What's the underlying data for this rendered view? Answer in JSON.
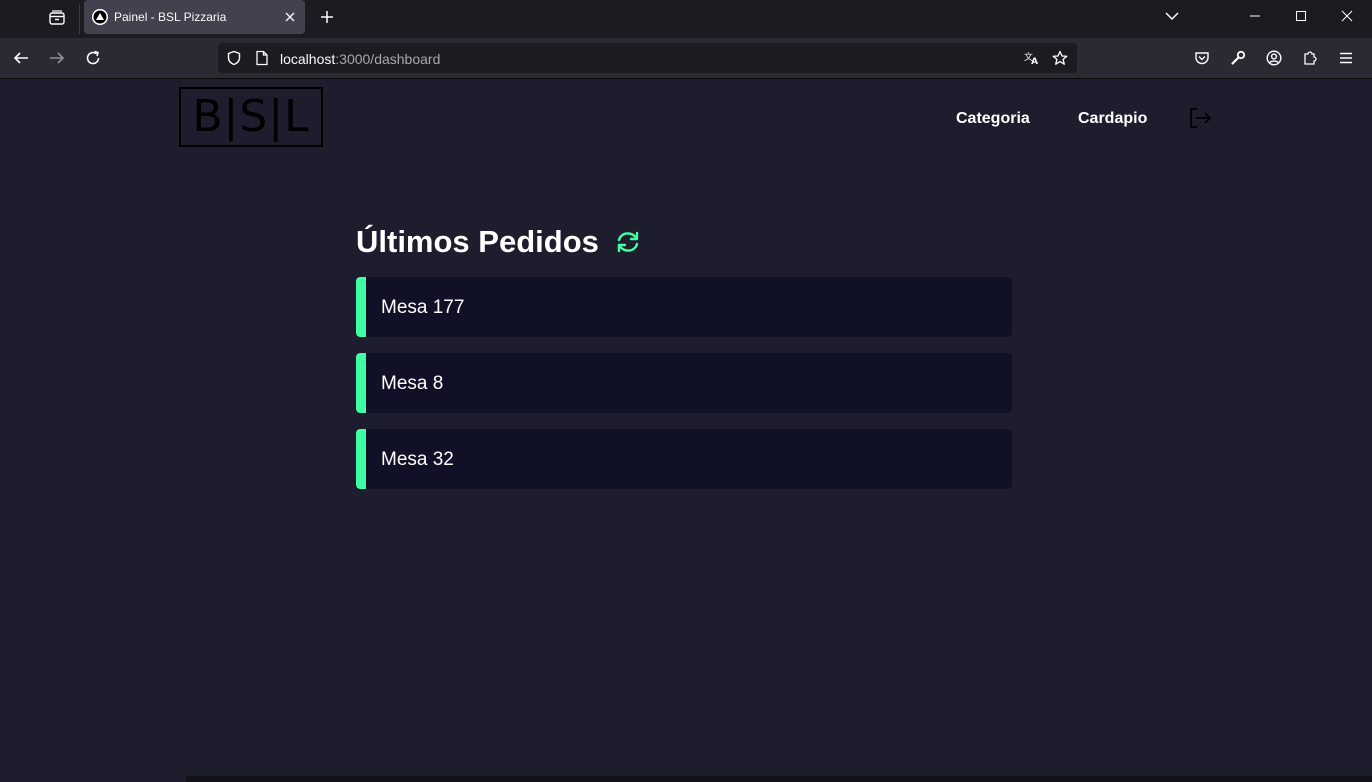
{
  "browser": {
    "tab_title": "Painel - BSL Pizzaria",
    "url_host": "localhost",
    "url_path": ":3000/dashboard"
  },
  "header": {
    "logo_text": "B|S|L",
    "nav": [
      {
        "label": "Categoria"
      },
      {
        "label": "Cardapio"
      }
    ]
  },
  "main": {
    "title": "Últimos Pedidos",
    "orders": [
      {
        "label": "Mesa 177"
      },
      {
        "label": "Mesa 8"
      },
      {
        "label": "Mesa 32"
      }
    ]
  },
  "colors": {
    "background": "#1d1d2e",
    "order_card": "#101026",
    "accent_green": "#3fffa3",
    "text": "#ffffff"
  },
  "icons": {
    "tab_list": "tab-list-icon",
    "favicon": "triangle-favicon",
    "close_tab": "close-icon",
    "new_tab": "plus-icon",
    "back": "arrow-left-icon",
    "forward": "arrow-right-icon",
    "reload": "reload-icon",
    "shield": "shield-icon",
    "page": "page-icon",
    "translate": "translate-icon",
    "bookmark": "star-icon",
    "pocket": "pocket-icon",
    "tools": "wrench-icon",
    "account": "account-icon",
    "extensions": "puzzle-icon",
    "menu": "hamburger-icon",
    "logout": "logout-icon",
    "refresh": "refresh-icon"
  }
}
